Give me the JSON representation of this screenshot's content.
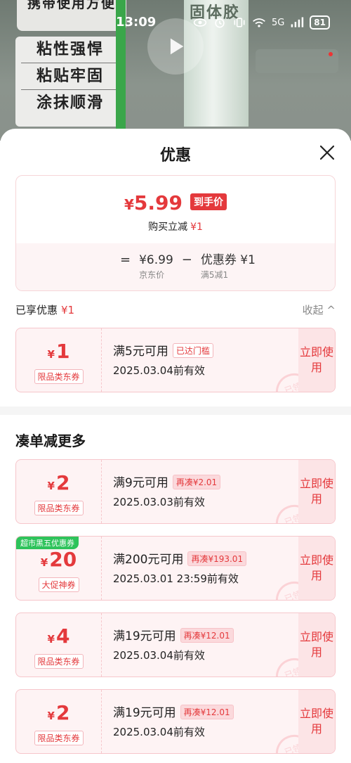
{
  "background": {
    "tag_top": "携带使用方便",
    "tag_lines": [
      "粘性强悍",
      "粘贴牢固",
      "涂抹顺滑"
    ],
    "tube_label": "固体胶"
  },
  "status_bar": {
    "time": "13:09",
    "network": "5G",
    "battery": "81"
  },
  "sheet": {
    "title": "优惠",
    "price_card": {
      "yen": "¥",
      "final_price": "5.99",
      "badge": "到手价",
      "buy_label": "购买立减",
      "buy_amount": "¥1",
      "eq": "=",
      "minus": "−",
      "jd_price": "¥6.99",
      "jd_price_label": "京东价",
      "coupon_value": "优惠券 ¥1",
      "coupon_rule": "满5减1"
    },
    "enjoyed": {
      "label": "已享优惠",
      "amount": "¥1",
      "collapse": "收起 ^"
    },
    "section_title": "凑单减更多",
    "coupons": [
      {
        "yen": "¥",
        "amount": "1",
        "type": "限品类东券",
        "cond": "满5元可用",
        "chip": "已达门槛",
        "valid": "2025.03.04前有效",
        "use": "立即使用",
        "stamp": "已领"
      },
      {
        "yen": "¥",
        "amount": "2",
        "type": "限品类东券",
        "cond": "满9元可用",
        "chip": "再凑¥2.01",
        "valid": "2025.03.03前有效",
        "use": "立即使用",
        "stamp": "已领"
      },
      {
        "yen": "¥",
        "amount": "20",
        "type": "大促神券",
        "badge": "超市黑五优惠券",
        "cond": "满200元可用",
        "chip": "再凑¥193.01",
        "valid": "2025.03.01 23:59前有效",
        "use": "立即使用",
        "stamp": "已领"
      },
      {
        "yen": "¥",
        "amount": "4",
        "type": "限品类东券",
        "cond": "满19元可用",
        "chip": "再凑¥12.01",
        "valid": "2025.03.04前有效",
        "use": "立即使用",
        "stamp": "已领"
      },
      {
        "yen": "¥",
        "amount": "2",
        "type": "限品类东券",
        "cond": "满19元可用",
        "chip": "再凑¥12.01",
        "valid": "2025.03.04前有效",
        "use": "立即使用",
        "stamp": "已领"
      }
    ]
  }
}
